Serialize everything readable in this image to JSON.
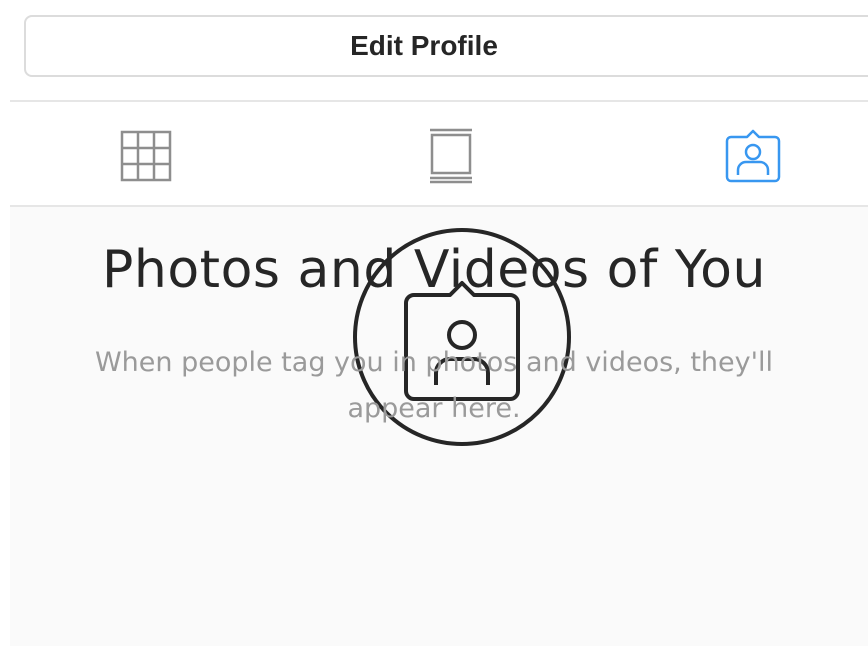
{
  "profile": {
    "edit_button_label": "Edit Profile"
  },
  "tabs": [
    {
      "icon": "grid-icon",
      "active": false
    },
    {
      "icon": "feed-list-icon",
      "active": false
    },
    {
      "icon": "tagged-user-icon",
      "active": true
    }
  ],
  "colors": {
    "active_tab": "#3897f0",
    "inactive_tab": "#8e8e8e",
    "title_text": "#262626",
    "subtitle_text": "#9a9a9a"
  },
  "empty_state": {
    "icon": "tagged-photo-icon",
    "title": "Photos and Videos of You",
    "description_line1": "When people tag you in photos and videos, they'll",
    "description_line2": "appear here."
  }
}
